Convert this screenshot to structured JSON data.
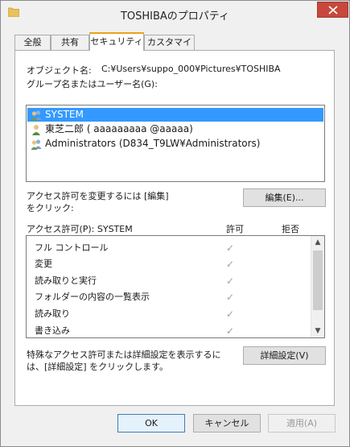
{
  "window": {
    "title": "TOSHIBAのプロパティ"
  },
  "tabs": [
    {
      "label": "全般",
      "active": false
    },
    {
      "label": "共有",
      "active": false
    },
    {
      "label": "セキュリティ",
      "active": true
    },
    {
      "label": "カスタマイズ",
      "active": false
    }
  ],
  "security": {
    "object_label": "オブジェクト名:",
    "object_value": "C:¥Users¥suppo_000¥Pictures¥TOSHIBA",
    "group_label": "グループ名またはユーザー名(G):",
    "groups": [
      {
        "name": "SYSTEM",
        "icon": "group-users-icon",
        "selected": true
      },
      {
        "name": "東芝二郎 ( aaaaaaaaa @aaaaa)",
        "icon": "user-icon",
        "selected": false
      },
      {
        "name": "Administrators (D834_T9LW¥Administrators)",
        "icon": "group-users-icon",
        "selected": false
      }
    ],
    "change_hint_line1": "アクセス許可を変更するには [編集]",
    "change_hint_line2": "をクリック:",
    "edit_button": "編集(E)...",
    "permissions_label": "アクセス許可(P): SYSTEM",
    "allow_header": "許可",
    "deny_header": "拒否",
    "permissions": [
      {
        "name": "フル コントロール",
        "allow": "✓",
        "deny": ""
      },
      {
        "name": "変更",
        "allow": "✓",
        "deny": ""
      },
      {
        "name": "読み取りと実行",
        "allow": "✓",
        "deny": ""
      },
      {
        "name": "フォルダーの内容の一覧表示",
        "allow": "✓",
        "deny": ""
      },
      {
        "name": "読み取り",
        "allow": "✓",
        "deny": ""
      },
      {
        "name": "書き込み",
        "allow": "✓",
        "deny": ""
      }
    ],
    "advanced_hint_line1": "特殊なアクセス許可または詳細設定を表示するに",
    "advanced_hint_line2": "は、[詳細設定] をクリックします。",
    "advanced_button": "詳細設定(V)"
  },
  "footer": {
    "ok": "OK",
    "cancel": "キャンセル",
    "apply": "適用(A)"
  },
  "colors": {
    "selection": "#3399ff",
    "close_button": "#c7483c",
    "active_tab_accent": "#e8a317"
  }
}
